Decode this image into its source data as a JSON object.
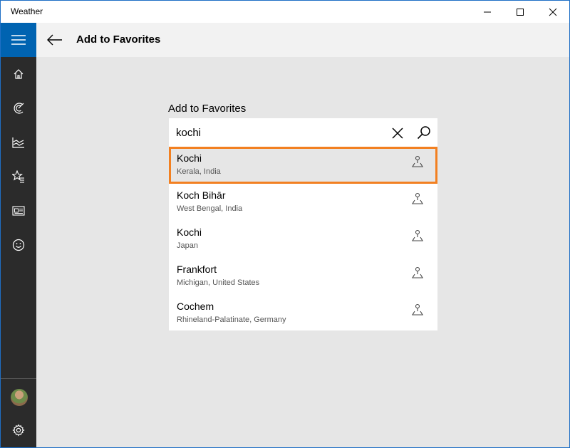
{
  "window": {
    "app_title": "Weather",
    "controls": [
      "minimize-icon",
      "maximize-icon",
      "close-icon"
    ]
  },
  "sidebar": {
    "accent_color": "#0063b1",
    "items": [
      {
        "icon": "hamburger-menu-icon"
      },
      {
        "icon": "home-icon"
      },
      {
        "icon": "maps-radar-icon"
      },
      {
        "icon": "historical-weather-icon"
      },
      {
        "icon": "favorites-icon"
      },
      {
        "icon": "news-icon"
      },
      {
        "icon": "feedback-smiley-icon"
      },
      {
        "icon": "avatar"
      },
      {
        "icon": "settings-gear-icon"
      }
    ]
  },
  "header": {
    "title": "Add to Favorites"
  },
  "panel": {
    "label": "Add to Favorites",
    "search": {
      "value": "kochi",
      "placeholder": ""
    }
  },
  "results": [
    {
      "name": "Kochi",
      "region": "Kerala, India",
      "selected": true
    },
    {
      "name": "Koch Bihār",
      "region": "West Bengal, India",
      "selected": false
    },
    {
      "name": "Kochi",
      "region": "Japan",
      "selected": false
    },
    {
      "name": "Frankfort",
      "region": "Michigan, United States",
      "selected": false
    },
    {
      "name": "Cochem",
      "region": "Rhineland-Palatinate, Germany",
      "selected": false
    }
  ],
  "colors": {
    "selection_border": "#f28021",
    "sidebar_bg": "#2b2b2b",
    "content_bg": "#e6e6e6"
  }
}
